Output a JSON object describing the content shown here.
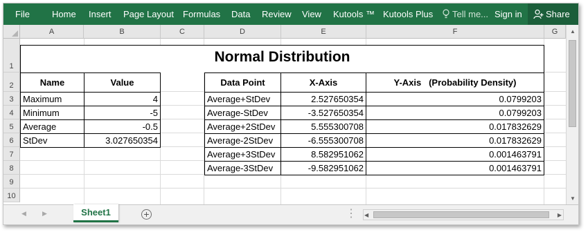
{
  "ribbon": {
    "file": "File",
    "tabs": [
      "Home",
      "Insert",
      "Page Layout",
      "Formulas",
      "Data",
      "Review",
      "View",
      "Kutools ™",
      "Kutools Plus"
    ],
    "tell_me": "Tell me...",
    "sign_in": "Sign in",
    "share": "Share",
    "accent_color": "#217346"
  },
  "columns": [
    "A",
    "B",
    "C",
    "D",
    "E",
    "F",
    "G"
  ],
  "rows": [
    "1",
    "2",
    "3",
    "4",
    "5",
    "6",
    "7",
    "8",
    "9",
    "10"
  ],
  "sheet": {
    "title": "Normal Distribution",
    "left_table": {
      "headers": [
        "Name",
        "Value"
      ],
      "rows": [
        [
          "Maximum",
          "4"
        ],
        [
          "Minimum",
          "-5"
        ],
        [
          "Average",
          "-0.5"
        ],
        [
          "StDev",
          "3.027650354"
        ]
      ]
    },
    "right_table": {
      "headers": [
        "Data Point",
        "X-Axis",
        "Y-Axis   (Probability Density)"
      ],
      "rows": [
        [
          "Average+StDev",
          "2.527650354",
          "0.0799203"
        ],
        [
          "Average-StDev",
          "-3.527650354",
          "0.0799203"
        ],
        [
          "Average+2StDev",
          "5.555300708",
          "0.017832629"
        ],
        [
          "Average-2StDev",
          "-6.555300708",
          "0.017832629"
        ],
        [
          "Average+3StDev",
          "8.582951062",
          "0.001463791"
        ],
        [
          "Average-3StDev",
          "-9.582951062",
          "0.001463791"
        ]
      ]
    }
  },
  "sheet_tabs": [
    "Sheet1"
  ]
}
